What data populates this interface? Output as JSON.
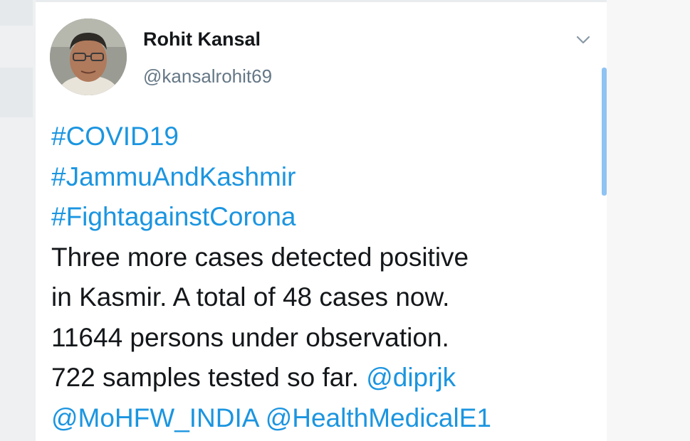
{
  "tweet": {
    "author": {
      "display_name": "Rohit Kansal",
      "handle": "@kansalrohit69"
    },
    "menu_icon": "chevron-down-icon",
    "hashtags": [
      "#COVID19",
      "#JammuAndKashmir",
      "#FightagainstCorona"
    ],
    "body": {
      "line1": "Three more cases detected positive",
      "line2": "in Kasmir. A total of 48 cases now.",
      "line3": "11644 persons under observation.",
      "line4": "722 samples tested so far. "
    },
    "mentions": [
      "@diprjk",
      "@MoHFW_INDIA",
      "@HealthMedicalE1"
    ]
  },
  "colors": {
    "link": "#1b95e0",
    "text": "#14171a",
    "secondary": "#657786",
    "scrollbar": "#8fc3f2"
  }
}
